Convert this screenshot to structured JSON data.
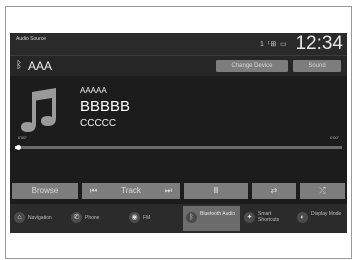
{
  "status": {
    "source_title": "Audio Source",
    "icons": "1 ᵗ⊞ ▭",
    "clock": "12:34"
  },
  "device": {
    "name": "AAA",
    "change_device": "Change Device",
    "sound": "Sound"
  },
  "now_playing": {
    "artist": "AAAAA",
    "album": "BBBBB",
    "title": "CCCCC",
    "elapsed": "0'00\"",
    "total": "0'00\"",
    "progress": 0.01
  },
  "controls": {
    "browse": "Browse",
    "prev": "⏮",
    "track": "Track",
    "next": "⏭",
    "pause": "II",
    "repeat": "⇄",
    "shuffle": "⤮"
  },
  "nav": [
    {
      "label": "Navigation",
      "icon": "home-icon"
    },
    {
      "label": "Phone",
      "icon": "phone-icon"
    },
    {
      "label": "FM",
      "icon": "radio-icon"
    },
    {
      "label": "Bluetooth Audio",
      "icon": "bluetooth-icon",
      "active": true
    },
    {
      "label": "Smart Shortcuts",
      "icon": "shortcut-icon"
    },
    {
      "label": "Display Mode",
      "icon": "display-icon"
    }
  ],
  "colors": {
    "screen_bg": "#1c1c1c",
    "button": "#7d7d7d",
    "active_tab": "#6c6c6c"
  }
}
